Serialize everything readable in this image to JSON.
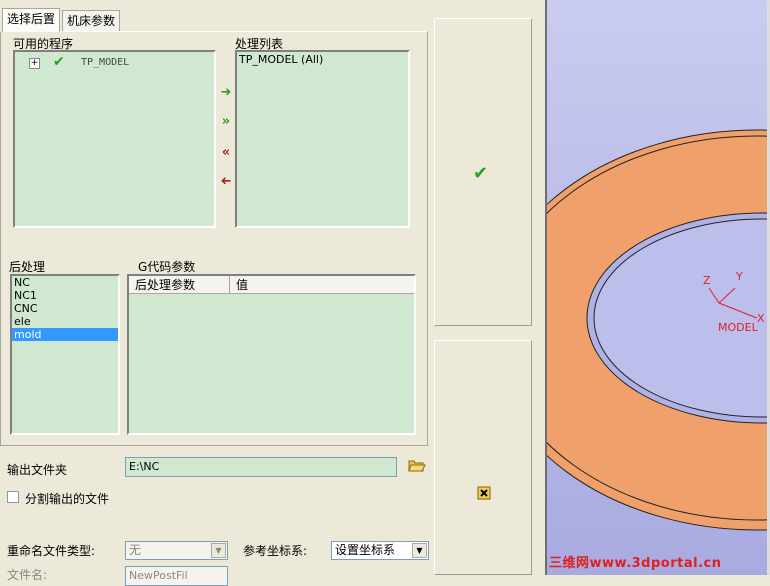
{
  "tabs": [
    {
      "label": "选择后置"
    },
    {
      "label": "机床参数"
    }
  ],
  "programs": {
    "title": "可用的程序",
    "items": [
      {
        "expander": "+",
        "name": "TP_MODEL"
      }
    ]
  },
  "process_list": {
    "title": "处理列表",
    "items": [
      "TP_MODEL (All)"
    ]
  },
  "postprocessor": {
    "title": "后处理",
    "items": [
      "NC",
      "NC1",
      "CNC",
      "ele",
      "mold"
    ],
    "selected": "mold"
  },
  "gcode": {
    "title": "G代码参数",
    "columns": [
      "后处理参数",
      "值"
    ]
  },
  "output": {
    "folder_label": "输出文件夹",
    "folder_value": "E:\\NC",
    "split_label": "分割输出的文件",
    "rename_label": "重命名文件类型:",
    "rename_value": "无",
    "ref_coord_label": "参考坐标系:",
    "ref_coord_value": "设置坐标系",
    "filename_label": "文件名:",
    "filename_value": "NewPostFil"
  },
  "viewport": {
    "axis_x": "X",
    "axis_y": "Y",
    "axis_z": "Z",
    "model_label": "MODEL",
    "watermark": "三维网www.3dportal.cn",
    "colors": {
      "background": "#b7b9e8",
      "part": "#f0a06a",
      "axes": "#e0202a"
    }
  },
  "icons": {
    "ok": "checkmark-icon",
    "cancel": "cancel-icon",
    "folder": "open-folder-icon"
  }
}
